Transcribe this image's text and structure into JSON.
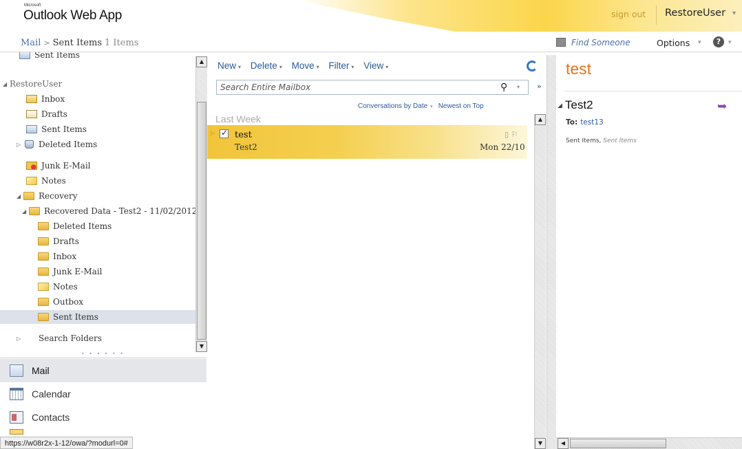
{
  "app": {
    "brand_small": "Microsoft",
    "brand": "Outlook Web App",
    "sign_out": "sign out",
    "user_name": "RestoreUser"
  },
  "breadcrumb": {
    "root": "Mail",
    "folder": "Sent Items",
    "count": "1 Items"
  },
  "top_links": {
    "find_someone": "Find Someone",
    "options": "Options",
    "help": "?"
  },
  "tree": {
    "items": [
      {
        "label": "Sent Items",
        "icon": "sent-folder-icon"
      },
      {
        "label": "RestoreUser",
        "icon": "expand-arrow"
      },
      {
        "label": "Inbox",
        "icon": "inbox-icon"
      },
      {
        "label": "Drafts",
        "icon": "drafts-icon"
      },
      {
        "label": "Sent Items",
        "icon": "sent-folder-icon"
      },
      {
        "label": "Deleted Items",
        "icon": "deleted-items-icon"
      },
      {
        "label": "Junk E-Mail",
        "icon": "junk-mail-icon"
      },
      {
        "label": "Notes",
        "icon": "notes-icon"
      },
      {
        "label": "Recovery",
        "icon": "folder-icon"
      },
      {
        "label": "Recovered Data - Test2 - 11/02/2012",
        "icon": "folder-icon"
      },
      {
        "label": "Deleted Items",
        "icon": "folder-icon"
      },
      {
        "label": "Drafts",
        "icon": "folder-icon"
      },
      {
        "label": "Inbox",
        "icon": "folder-icon"
      },
      {
        "label": "Junk E-Mail",
        "icon": "folder-icon"
      },
      {
        "label": "Notes",
        "icon": "notes-icon"
      },
      {
        "label": "Outbox",
        "icon": "folder-icon"
      },
      {
        "label": "Sent Items",
        "icon": "folder-icon",
        "selected": true
      },
      {
        "label": "Search Folders",
        "icon": "search-folders-icon"
      }
    ]
  },
  "nav": {
    "mail": "Mail",
    "calendar": "Calendar",
    "contacts": "Contacts"
  },
  "status_bar": "https://w08r2x-1-12/owa/?modurl=0#",
  "toolbar": {
    "new": "New",
    "delete": "Delete",
    "move": "Move",
    "filter": "Filter",
    "view": "View"
  },
  "search": {
    "placeholder": "Search Entire Mailbox"
  },
  "sort": {
    "arrange": "Conversations by Date",
    "order": "Newest on Top"
  },
  "message_list": {
    "group_label": "Last Week",
    "messages": [
      {
        "subject": "test",
        "from": "Test2",
        "date": "Mon 22/10",
        "selected": true
      }
    ]
  },
  "reading_pane": {
    "title": "test",
    "sender": "Test2",
    "to_label": "To:",
    "to_value": "test13",
    "folder": "Sent Items,",
    "folder_italic": "Sent Items"
  },
  "colors": {
    "accent_orange": "#e7731c",
    "link_blue": "#2a5a9a",
    "selection_yellow": "#f1c53a",
    "reply_purple": "#8a4aa8"
  }
}
